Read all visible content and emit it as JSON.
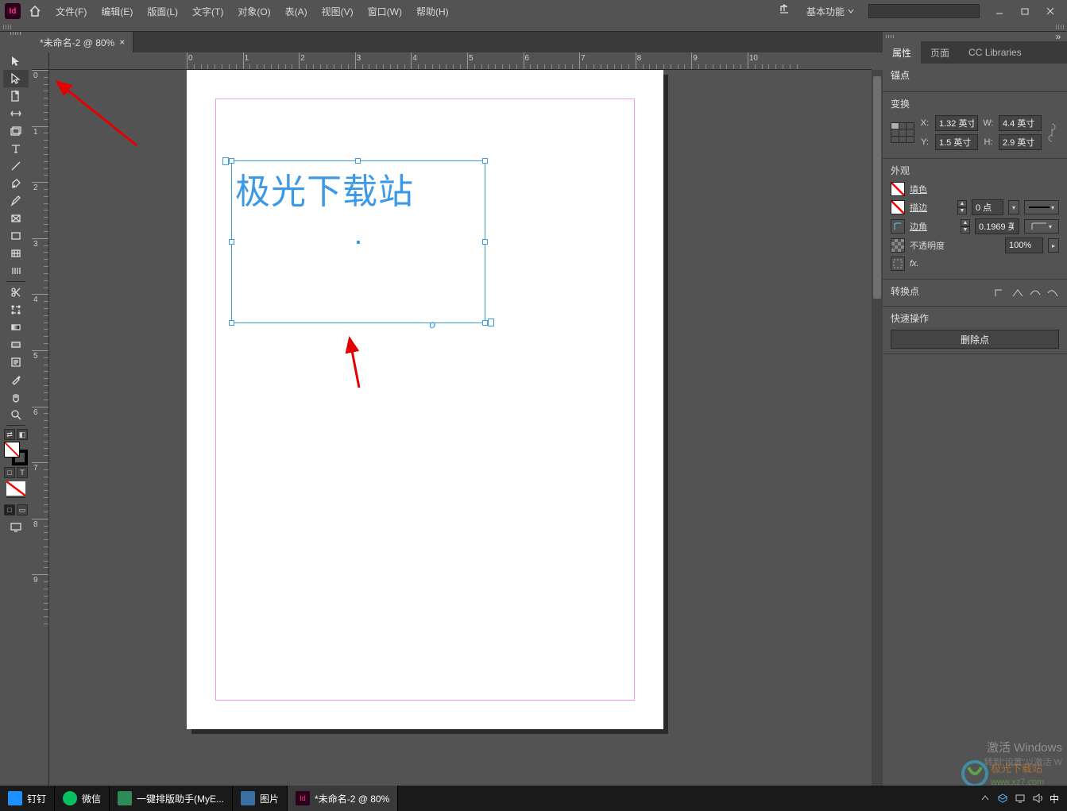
{
  "menubar": {
    "app_badge": "Id",
    "items": [
      "文件(F)",
      "编辑(E)",
      "版面(L)",
      "文字(T)",
      "对象(O)",
      "表(A)",
      "视图(V)",
      "窗口(W)",
      "帮助(H)"
    ],
    "workspace_label": "基本功能"
  },
  "document": {
    "tab_title": "*未命名-2 @ 80%",
    "text_content": "极光下载站"
  },
  "ruler": {
    "h_labels": [
      "0",
      "1",
      "2",
      "3",
      "4",
      "5",
      "6",
      "7",
      "8",
      "9",
      "10"
    ],
    "v_labels": [
      "0",
      "1",
      "2",
      "3",
      "4",
      "5",
      "6",
      "7",
      "8",
      "9"
    ]
  },
  "panels": {
    "tabs": [
      "属性",
      "页面",
      "CC Libraries"
    ],
    "anchor_title": "锚点",
    "transform_title": "变换",
    "x_label": "X:",
    "y_label": "Y:",
    "w_label": "W:",
    "h_label": "H:",
    "x_value": "1.32 英寸",
    "y_value": "1.5 英寸",
    "w_value": "4.4 英寸",
    "h_value": "2.9 英寸",
    "appearance_title": "外观",
    "fill_label": "填色",
    "stroke_label": "描边",
    "stroke_value": "0 点",
    "corner_label": "边角",
    "corner_value": "0.1969 英",
    "opacity_label": "不透明度",
    "opacity_value": "100%",
    "fx_label": "fx.",
    "convert_title": "转换点",
    "quick_title": "快速操作",
    "quick_delete": "删除点"
  },
  "watermark": {
    "line1": "激活 Windows",
    "line2": "转到\"设置\"以激活 W"
  },
  "site_logo": {
    "text_top": "极光下载站",
    "text_bottom": "www.xz7.com"
  },
  "taskbar": {
    "items": [
      {
        "label": "钉钉",
        "color": "#1e90ff"
      },
      {
        "label": "微信",
        "color": "#07c160"
      },
      {
        "label": "一键排版助手(MyE...",
        "color": "#2e8b57"
      },
      {
        "label": "图片",
        "color": "#3a6ea5"
      },
      {
        "label": "*未命名-2 @ 80%",
        "color": "#2d001d"
      }
    ],
    "ime": "中"
  }
}
